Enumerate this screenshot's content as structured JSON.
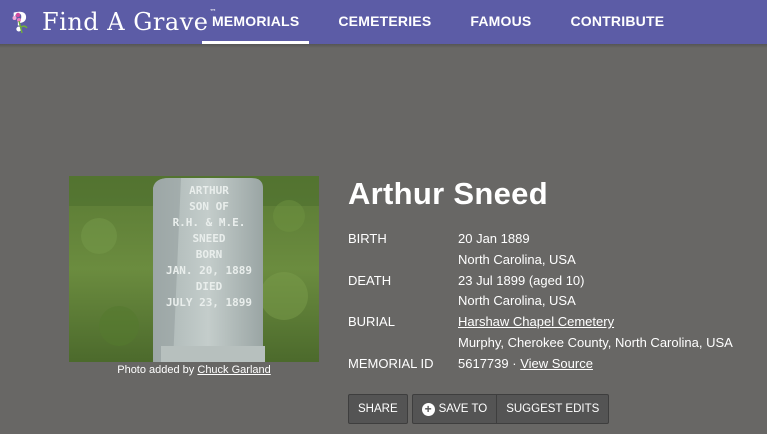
{
  "header": {
    "logo_text": "Find A Grave",
    "logo_tm": "™",
    "nav": [
      "MEMORIALS",
      "CEMETERIES",
      "FAMOUS",
      "CONTRIBUTE"
    ]
  },
  "photo": {
    "caption_prefix": "Photo added by",
    "caption_author": "Chuck Garland",
    "inscription": [
      "ARTHUR",
      "SON OF",
      "R.H. & M.E.",
      "SNEED",
      "BORN",
      "JAN. 20, 1889",
      "DIED",
      "JULY 23, 1899"
    ]
  },
  "memorial": {
    "name": "Arthur Sneed",
    "birth_label": "BIRTH",
    "birth_date": "20 Jan 1889",
    "birth_place": "North Carolina, USA",
    "death_label": "DEATH",
    "death_date": "23 Jul 1899 (aged 10)",
    "death_place": "North Carolina, USA",
    "burial_label": "BURIAL",
    "burial_cemetery": "Harshaw Chapel Cemetery",
    "burial_place": "Murphy, Cherokee County, North Carolina, USA",
    "memorial_id_label": "MEMORIAL ID",
    "memorial_id": "5617739",
    "memorial_id_sep": " · ",
    "view_source": "View Source"
  },
  "actions": {
    "share": "SHARE",
    "save_to": "SAVE TO",
    "suggest_edits": "SUGGEST EDITS"
  },
  "colors": {
    "header_bg": "#5c5ca6",
    "page_bg": "#686765",
    "button_bg": "#545454"
  }
}
